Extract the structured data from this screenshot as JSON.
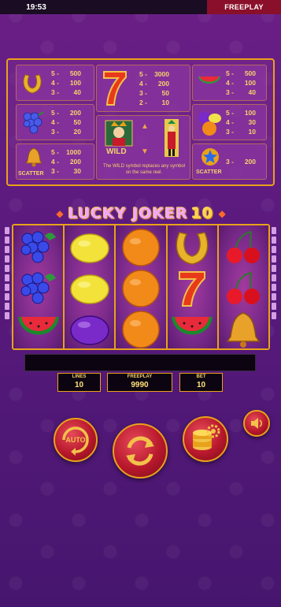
{
  "status_bar": {
    "time": "19:53",
    "mode": "FREEPLAY"
  },
  "paytable": {
    "horseshoe": {
      "icon": "horseshoe-icon",
      "pays": [
        [
          "5 -",
          "500"
        ],
        [
          "4 -",
          "100"
        ],
        [
          "3 -",
          "40"
        ]
      ]
    },
    "grapes": {
      "icon": "grapes-icon",
      "pays": [
        [
          "5 -",
          "200"
        ],
        [
          "4 -",
          "50"
        ],
        [
          "3 -",
          "20"
        ]
      ]
    },
    "bell": {
      "icon": "bell-icon",
      "label": "SCATTER",
      "pays": [
        [
          "5 -",
          "1000"
        ],
        [
          "4 -",
          "200"
        ],
        [
          "3 -",
          "30"
        ]
      ]
    },
    "seven": {
      "icon": "seven-icon",
      "pays": [
        [
          "5 -",
          "3000"
        ],
        [
          "4 -",
          "200"
        ],
        [
          "3 -",
          "50"
        ],
        [
          "2 -",
          "10"
        ]
      ]
    },
    "wild": {
      "icon": "joker-wild-icon",
      "label": "WILD",
      "text": "The WILD symbol replaces any symbol on the same reel."
    },
    "watermelon": {
      "icon": "watermelon-icon",
      "pays": [
        [
          "5 -",
          "500"
        ],
        [
          "4 -",
          "100"
        ],
        [
          "3 -",
          "40"
        ]
      ]
    },
    "fruits": {
      "icon": "plum-lemon-orange-icon",
      "pays": [
        [
          "5 -",
          "100"
        ],
        [
          "4 -",
          "30"
        ],
        [
          "3 -",
          "10"
        ]
      ]
    },
    "star": {
      "icon": "star-icon",
      "label": "SCATTER",
      "pays": [
        [
          "3 -",
          "200"
        ]
      ]
    }
  },
  "game": {
    "title": "LUCKY JOKER",
    "title_number": "10"
  },
  "reels": [
    [
      "grapes",
      "grapes",
      "watermelon"
    ],
    [
      "lemon",
      "lemon",
      "plum"
    ],
    [
      "orange",
      "orange",
      "orange"
    ],
    [
      "horseshoe",
      "seven",
      "watermelon"
    ],
    [
      "cherries",
      "cherries",
      "bell"
    ]
  ],
  "info": {
    "lines_label": "LINES",
    "lines_value": "10",
    "freeplay_label": "FREEPLAY",
    "freeplay_value": "9990",
    "bet_label": "BET",
    "bet_value": "10"
  },
  "controls": {
    "auto_label": "AUTO",
    "spin": "spin-icon",
    "bet": "coins-gear-icon",
    "sound": "speaker-icon"
  }
}
